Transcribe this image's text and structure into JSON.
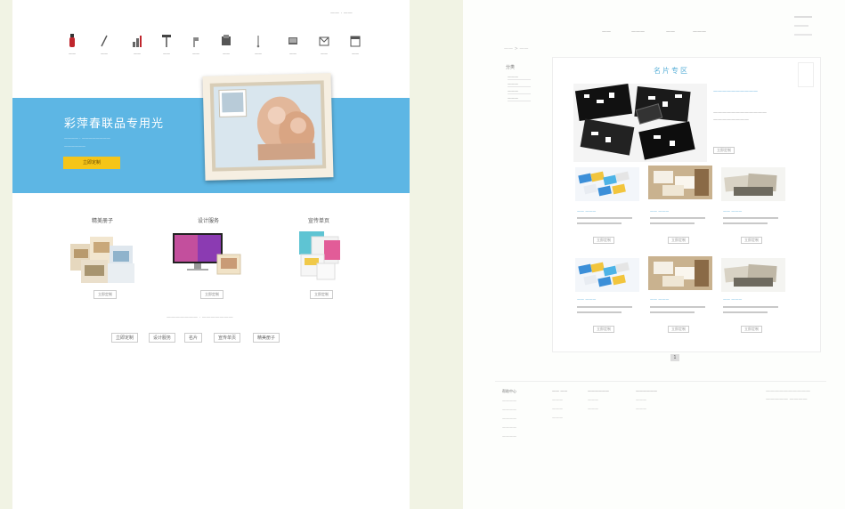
{
  "left_page": {
    "top_links": "—— · ——",
    "nav": [
      {
        "label": "——",
        "icon": "bottle-icon"
      },
      {
        "label": "——",
        "icon": "pen-icon"
      },
      {
        "label": "——",
        "icon": "chart-icon"
      },
      {
        "label": "——",
        "icon": "stand-icon"
      },
      {
        "label": "——",
        "icon": "flag-icon"
      },
      {
        "label": "——",
        "icon": "box-icon"
      },
      {
        "label": "——",
        "icon": "tag-icon"
      },
      {
        "label": "——",
        "icon": "display-icon"
      },
      {
        "label": "——",
        "icon": "envelope-icon"
      },
      {
        "label": "——",
        "icon": "calendar-icon"
      }
    ],
    "banner": {
      "title": "彩萍春联品专用光",
      "sub1": "———— · ————————",
      "sub2": "——————",
      "button": "立即定制",
      "color": "#5db6e4",
      "button_color": "#f5c518"
    },
    "categories": [
      {
        "title": "精美册子",
        "button": "立即定制"
      },
      {
        "title": "设计服务",
        "button": "立即定制"
      },
      {
        "title": "宣传单页",
        "button": "立即定制"
      }
    ],
    "divider_text": "——————— · ———————",
    "tags": [
      "立即定制",
      "设计服务",
      "名片",
      "宣传单页",
      "精美册子"
    ]
  },
  "right_page": {
    "topnav": [
      "——",
      "———",
      "——",
      "———"
    ],
    "breadcrumb": "—— > ——",
    "sidebar": {
      "heading": "分类",
      "items": [
        "———",
        "———",
        "———",
        "———"
      ]
    },
    "section_title": "名片专区",
    "featured": {
      "title": "——————————",
      "desc1": "————————————",
      "desc2": "————————",
      "button": "立即定制"
    },
    "products": [
      {
        "title": "—— ———",
        "button": "立即定制"
      },
      {
        "title": "—— ———",
        "button": "立即定制"
      },
      {
        "title": "—— ———",
        "button": "立即定制"
      },
      {
        "title": "—— ———",
        "button": "立即定制"
      },
      {
        "title": "—— ———",
        "button": "立即定制"
      },
      {
        "title": "—— ———",
        "button": "立即定制"
      }
    ],
    "pagination": "1",
    "footer": {
      "columns": [
        {
          "heading": "帮助中心",
          "items": [
            "————",
            "————",
            "————",
            "————",
            "————"
          ]
        },
        {
          "heading": "—— ——",
          "items": [
            "———",
            "———",
            "———"
          ]
        },
        {
          "heading": "——————",
          "items": [
            "———",
            "———"
          ]
        },
        {
          "heading": "——————",
          "items": [
            "———",
            "———"
          ]
        }
      ],
      "right1": "——————————",
      "right2": "—————  ————"
    }
  }
}
